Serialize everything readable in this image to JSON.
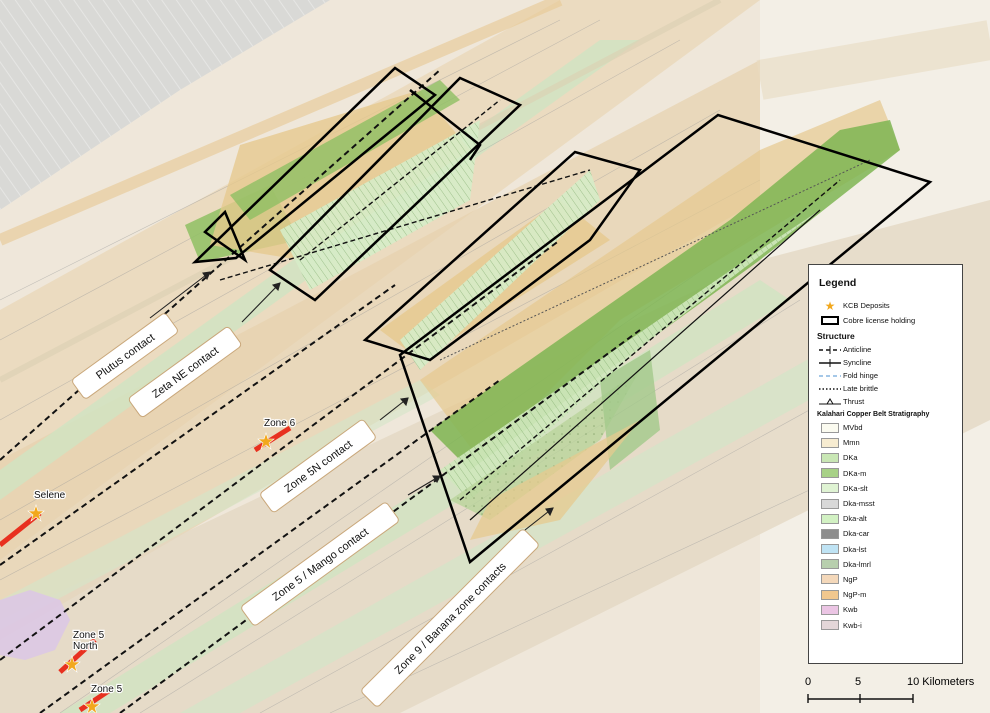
{
  "map": {
    "contacts": [
      {
        "id": "plutus",
        "label": "Plutus contact"
      },
      {
        "id": "zeta",
        "label": "Zeta NE contact"
      },
      {
        "id": "zone5n",
        "label": "Zone 5N contact"
      },
      {
        "id": "mango",
        "label": "Zone 5 / Mango contact"
      },
      {
        "id": "banana",
        "label": "Zone 9 / Banana zone contacts"
      }
    ],
    "deposits": [
      "Zone 6",
      "Selene",
      "Zone 5 North",
      "Zone 5"
    ],
    "colors": {
      "accent_star": "#f2a81d",
      "deposit_trend": "#e8301f",
      "license": "#000000"
    }
  },
  "legend": {
    "title": "Legend",
    "kcb": "KCB Deposits",
    "license": "Cobre license holding",
    "structure_header": "Structure",
    "structure": [
      "Anticline",
      "Syncline",
      "Fold hinge",
      "Late brittle",
      "Thrust"
    ],
    "strat_header": "Kalahari Copper Belt Stratigraphy",
    "strat": [
      {
        "name": "MVbd",
        "color": "#fbfbf0"
      },
      {
        "name": "Mmn",
        "color": "#f7ecd1"
      },
      {
        "name": "DKa",
        "color": "#c9e7b5"
      },
      {
        "name": "DKa-m",
        "color": "#a7d187"
      },
      {
        "name": "DKa-slt",
        "color": "#dff3d3"
      },
      {
        "name": "Dka-msst",
        "color": "#d8d8d8"
      },
      {
        "name": "Dka-alt",
        "color": "#d2f1c3"
      },
      {
        "name": "Dka-car",
        "color": "#8e8e8e"
      },
      {
        "name": "Dka-lst",
        "color": "#bfe3f4"
      },
      {
        "name": "Dka-lmrl",
        "color": "#b8cfae"
      },
      {
        "name": "NgP",
        "color": "#f4d8ba"
      },
      {
        "name": "NgP-m",
        "color": "#f1c78e"
      },
      {
        "name": "Kwb",
        "color": "#ebc5e4"
      },
      {
        "name": "Kwb-i",
        "color": "#e3d6d8"
      }
    ]
  },
  "scale": {
    "ticks": [
      "0",
      "5",
      "10 Kilometers"
    ]
  }
}
